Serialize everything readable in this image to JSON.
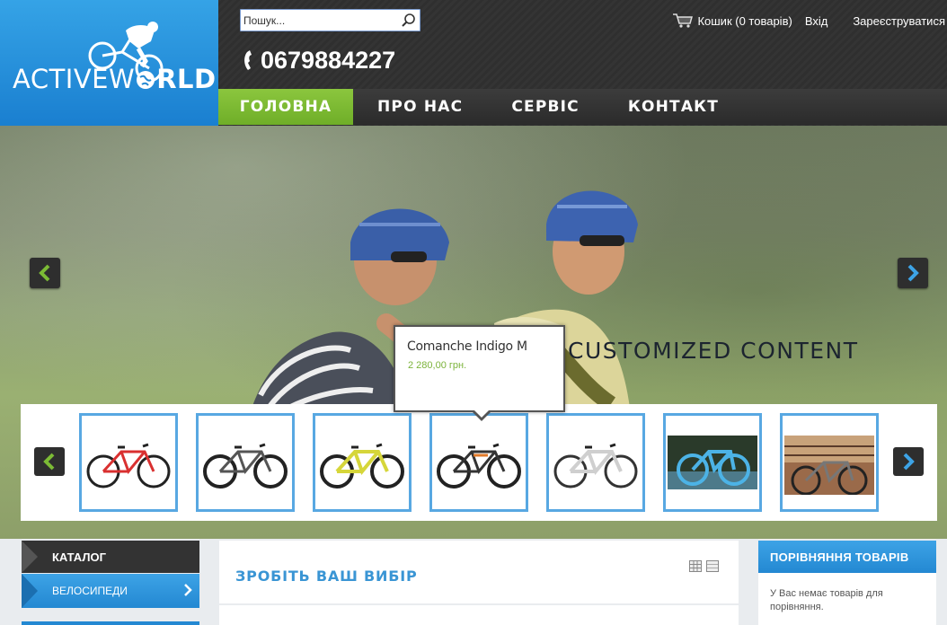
{
  "logo": {
    "text_light": "ACTIVEW",
    "text_bold": "RLD"
  },
  "search": {
    "placeholder": "Пошук...",
    "value": ""
  },
  "phone": {
    "number": "0679884227"
  },
  "top_links": {
    "cart": "Кошик (0 товарів)",
    "login": "Вхід",
    "register": "Зареєструватися"
  },
  "nav": {
    "items": [
      {
        "label": "ГОЛОВНА",
        "active": true
      },
      {
        "label": "ПРО НАС"
      },
      {
        "label": "СЕРВІС"
      },
      {
        "label": "КОНТАКТ"
      }
    ]
  },
  "slider": {
    "caption": "CUSTOMIZED CONTENT"
  },
  "tooltip": {
    "product_name": "Comanche Indigo M",
    "price": "2 280,00 грн."
  },
  "catalog": {
    "heading": "КАТАЛОГ",
    "items": [
      "ВЕЛОСИПЕДИ"
    ]
  },
  "main": {
    "title": "ЗРОБІТЬ ВАШ ВИБІР"
  },
  "compare": {
    "heading": "ПОРІВНЯННЯ ТОВАРІВ",
    "empty_text": "У Вас немає товарів для порівняння."
  },
  "colors": {
    "brand_blue": "#2388d2",
    "nav_active_green": "#7cbb35",
    "header_dark": "#2f2f2f",
    "price_green": "#7bb33a"
  }
}
